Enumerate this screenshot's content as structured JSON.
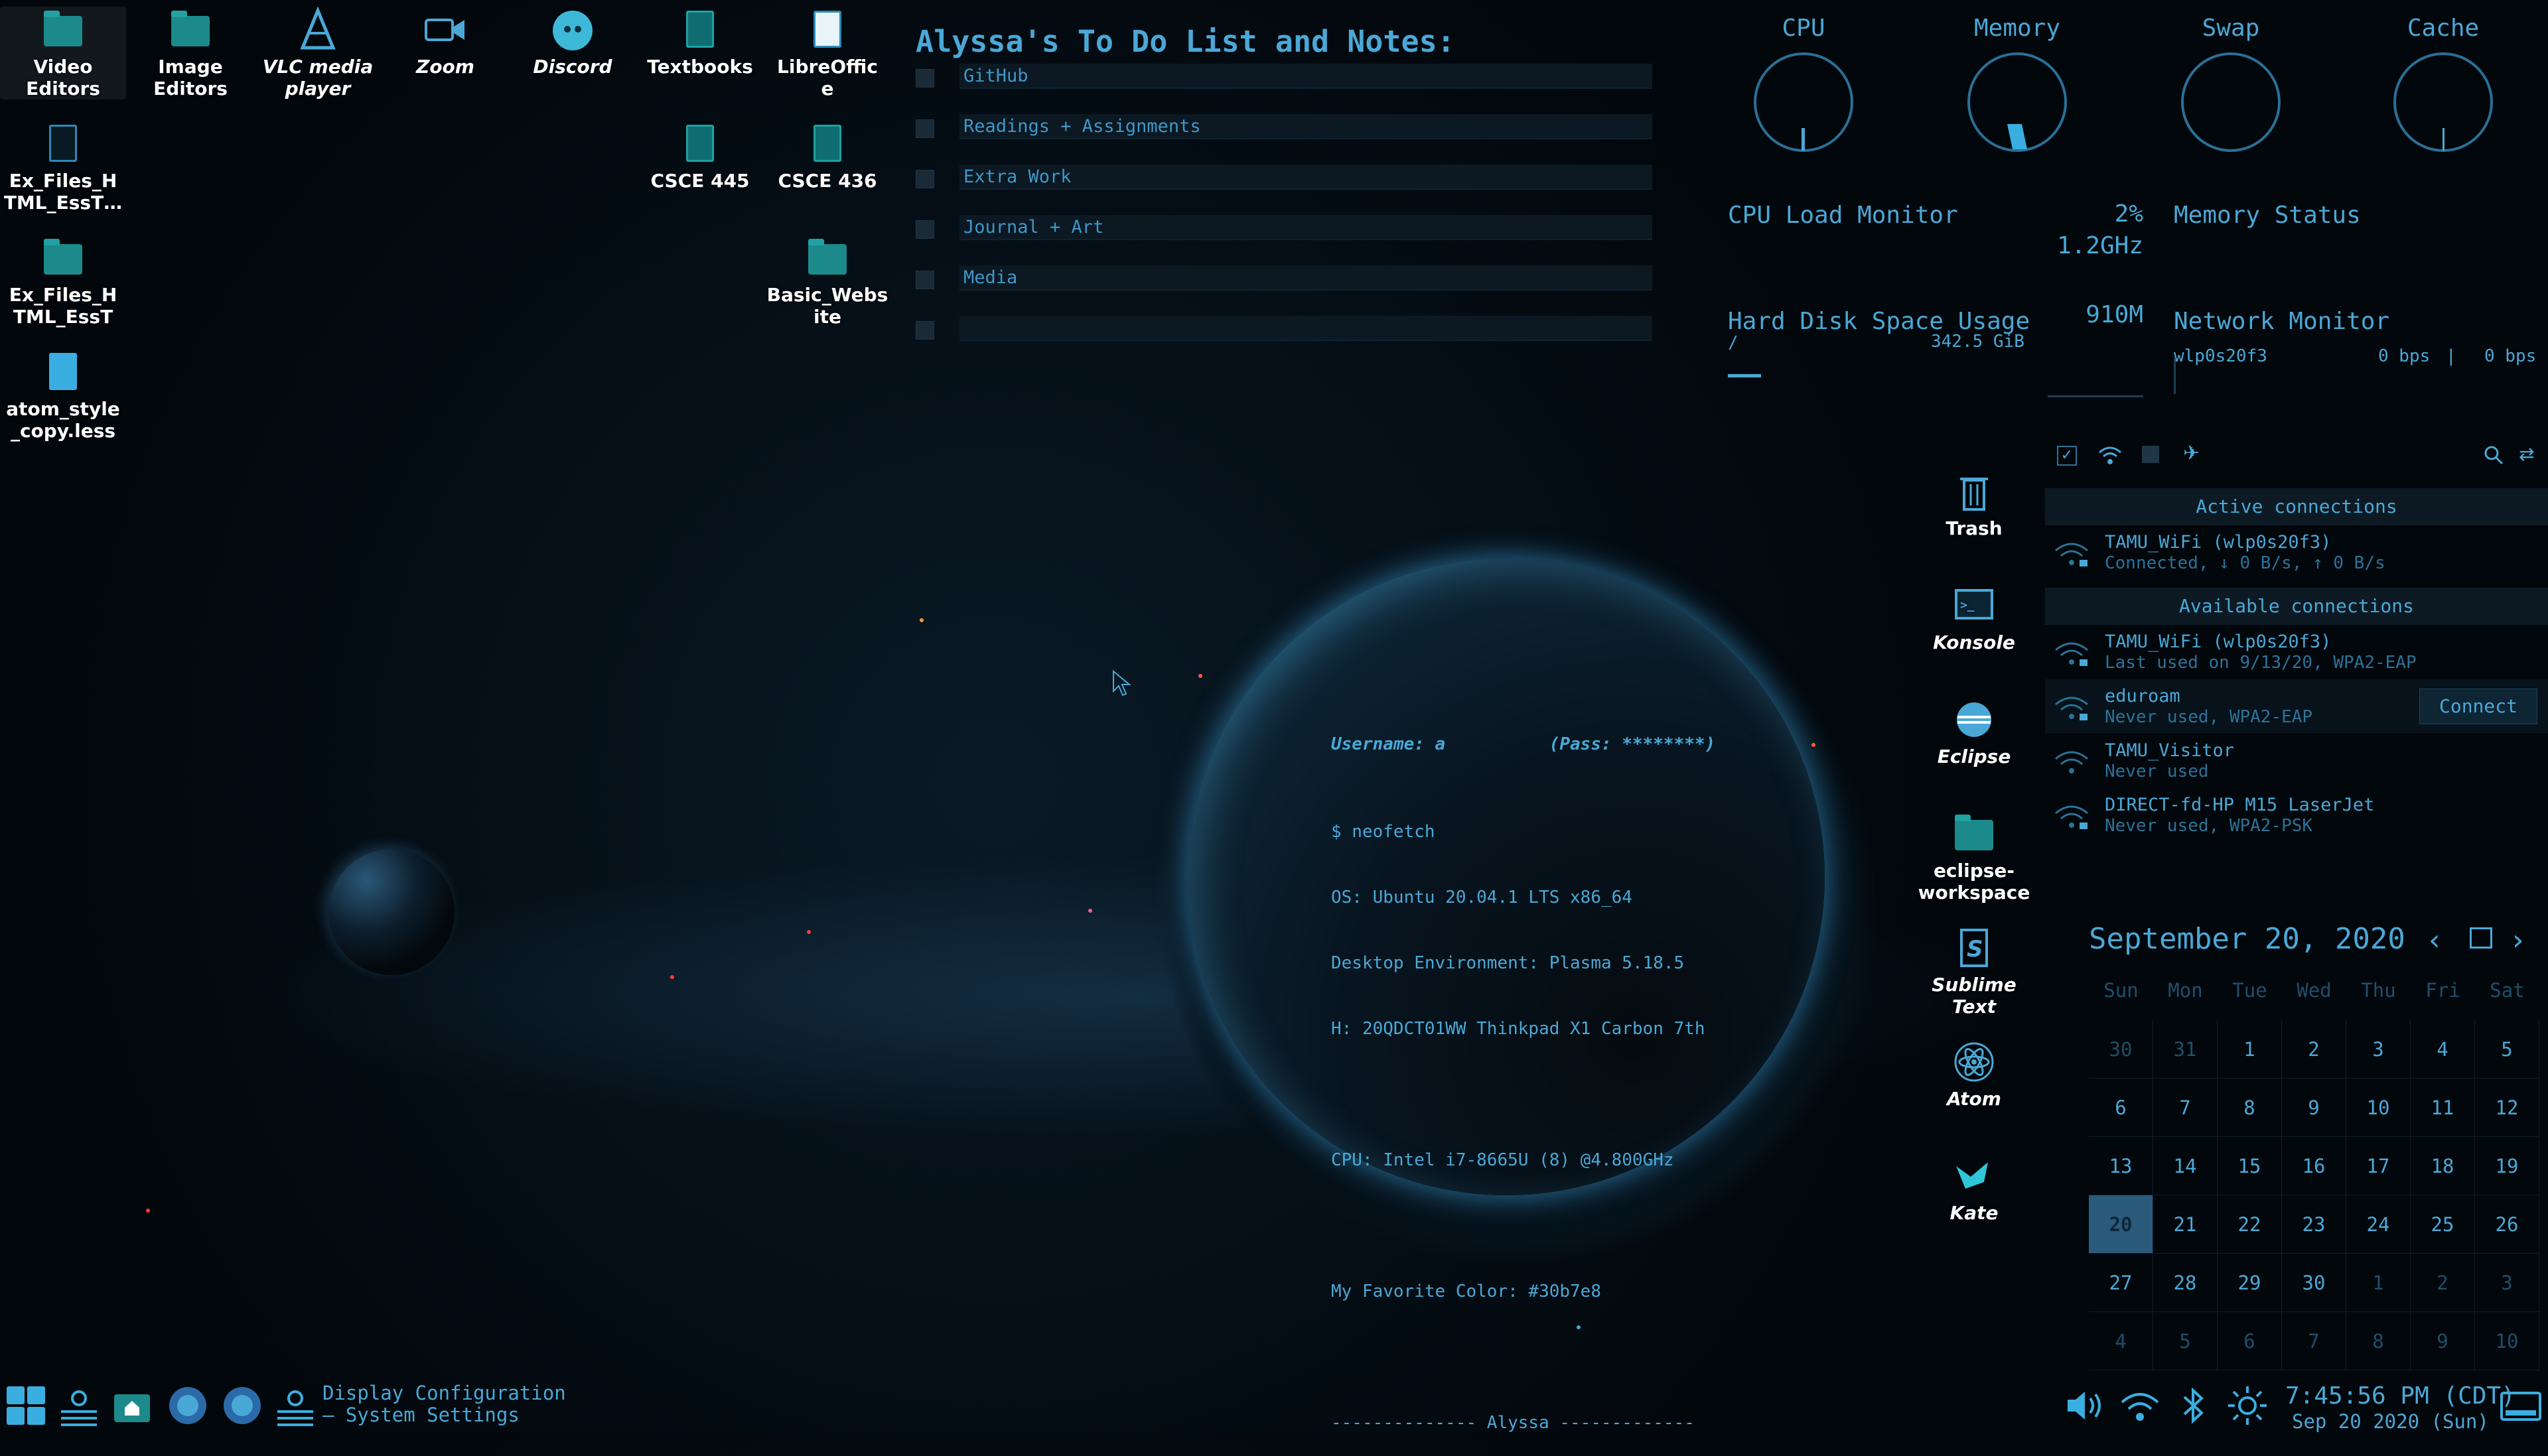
{
  "desktop_icons": [
    {
      "label": "Video\nEditors"
    },
    {
      "label": "Image\nEditors"
    },
    {
      "label": "VLC media\nplayer"
    },
    {
      "label": "Zoom"
    },
    {
      "label": "Discord"
    },
    {
      "label": "Textbooks"
    },
    {
      "label": "LibreOffic\ne"
    },
    {
      "label": "Ex_Files_H\nTML_EssT…"
    },
    {
      "label": "CSCE 445"
    },
    {
      "label": "CSCE 436"
    },
    {
      "label": "Ex_Files_H\nTML_EssT"
    },
    {
      "label": "Basic_Webs\nite"
    },
    {
      "label": "atom_style\n_copy.less"
    }
  ],
  "todo": {
    "title": "Alyssa's To Do List and Notes:",
    "items": [
      "GitHub",
      "Readings + Assignments",
      "Extra Work",
      "Journal + Art",
      "Media",
      ""
    ]
  },
  "system_monitor": {
    "gauges": [
      {
        "label": "CPU"
      },
      {
        "label": "Memory"
      },
      {
        "label": "Swap"
      },
      {
        "label": "Cache"
      }
    ],
    "cpu_load_label": "CPU Load Monitor",
    "cpu_percent": "2%",
    "cpu_freq": "1.2GHz",
    "memory_label": "Memory Status",
    "memory_used": "910M",
    "disk_label": "Hard Disk Space Usage",
    "disk_mount": "/",
    "disk_size": "342.5 GiB",
    "network_label": "Network Monitor",
    "network_iface": "wlp0s20f3",
    "network_down": "0 bps",
    "network_sep": "|",
    "network_up": "0 bps"
  },
  "network": {
    "active_header": "Active connections",
    "available_header": "Available connections",
    "active": [
      {
        "name": "TAMU_WiFi (wlp0s20f3)",
        "sub": "Connected, ↓ 0 B/s, ↑ 0 B/s"
      }
    ],
    "available": [
      {
        "name": "TAMU_WiFi (wlp0s20f3)",
        "sub": "Last used on 9/13/20, WPA2-EAP"
      },
      {
        "name": "eduroam",
        "sub": "Never used, WPA2-EAP"
      },
      {
        "name": "TAMU_Visitor",
        "sub": "Never used"
      },
      {
        "name": "DIRECT-fd-HP M15 LaserJet",
        "sub": "Never used, WPA2-PSK"
      }
    ],
    "connect_label": "Connect"
  },
  "neofetch": {
    "username_line": "Username: a          (Pass: ********)",
    "lines": [
      "$ neofetch",
      "OS: Ubuntu 20.04.1 LTS x86_64",
      "Desktop Environment: Plasma 5.18.5",
      "H: 20QDCT01WW Thinkpad X1 Carbon 7th",
      "",
      "CPU: Intel i7-8665U (8) @4.800GHz",
      "",
      "My Favorite Color: #30b7e8",
      "",
      "-------------- Alyssa -------------"
    ]
  },
  "right_icons": [
    {
      "label": "Trash"
    },
    {
      "label": "Konsole"
    },
    {
      "label": "Eclipse"
    },
    {
      "label": "eclipse-\nworkspace"
    },
    {
      "label": "Sublime\nText"
    },
    {
      "label": "Atom"
    },
    {
      "label": "Kate"
    }
  ],
  "calendar": {
    "title": "September 20, 2020",
    "weekdays": [
      "Sun",
      "Mon",
      "Tue",
      "Wed",
      "Thu",
      "Fri",
      "Sat"
    ],
    "weeks": [
      [
        [
          "30",
          "dim"
        ],
        [
          "31",
          "dim"
        ],
        [
          "1",
          ""
        ],
        [
          "2",
          ""
        ],
        [
          "3",
          ""
        ],
        [
          "4",
          ""
        ],
        [
          "5",
          ""
        ]
      ],
      [
        [
          "6",
          ""
        ],
        [
          "7",
          ""
        ],
        [
          "8",
          ""
        ],
        [
          "9",
          ""
        ],
        [
          "10",
          ""
        ],
        [
          "11",
          ""
        ],
        [
          "12",
          ""
        ]
      ],
      [
        [
          "13",
          ""
        ],
        [
          "14",
          ""
        ],
        [
          "15",
          ""
        ],
        [
          "16",
          ""
        ],
        [
          "17",
          ""
        ],
        [
          "18",
          ""
        ],
        [
          "19",
          ""
        ]
      ],
      [
        [
          "20",
          "today"
        ],
        [
          "21",
          ""
        ],
        [
          "22",
          ""
        ],
        [
          "23",
          ""
        ],
        [
          "24",
          ""
        ],
        [
          "25",
          ""
        ],
        [
          "26",
          ""
        ]
      ],
      [
        [
          "27",
          ""
        ],
        [
          "28",
          ""
        ],
        [
          "29",
          ""
        ],
        [
          "30",
          ""
        ],
        [
          "1",
          "dim"
        ],
        [
          "2",
          "dim"
        ],
        [
          "3",
          "dim"
        ]
      ],
      [
        [
          "4",
          "dim"
        ],
        [
          "5",
          "dim"
        ],
        [
          "6",
          "dim"
        ],
        [
          "7",
          "dim"
        ],
        [
          "8",
          "dim"
        ],
        [
          "9",
          "dim"
        ],
        [
          "10",
          "dim"
        ]
      ]
    ]
  },
  "taskbar": {
    "window_title": "Display Configuration\n— System Settings",
    "time": "7:45:56 PM (CDT)",
    "date": "Sep 20 2020 (Sun)"
  },
  "colors": {
    "accent": "#4aa8d6",
    "panel": "#0c1822",
    "today_highlight": "#2a5a7c"
  }
}
